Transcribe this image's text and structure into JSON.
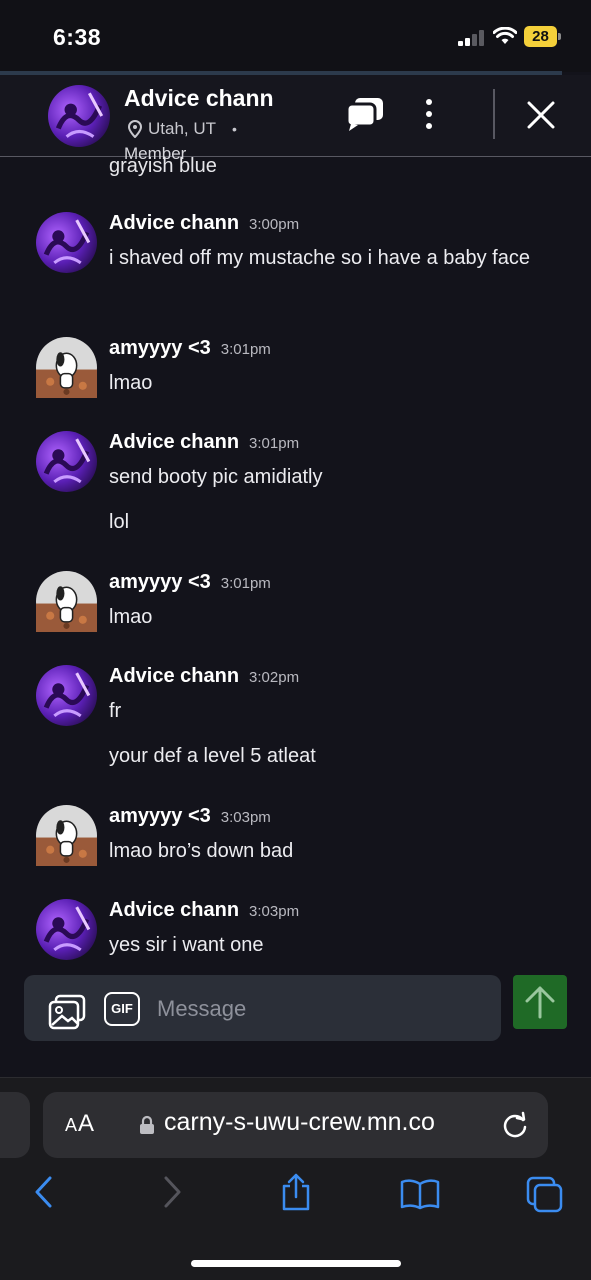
{
  "status_bar": {
    "time": "6:38",
    "battery": "28"
  },
  "header": {
    "name": "Advice chann",
    "location": "Utah, UT",
    "separator": "•",
    "role": "Member"
  },
  "messages": {
    "previous_text": "grayish blue",
    "items": [
      {
        "user": "Advice chann",
        "time": "3:00pm",
        "text": "i shaved off my mustache so i have a baby face",
        "extra": ""
      },
      {
        "user": "amyyyy <3",
        "time": "3:01pm",
        "text": "lmao",
        "extra": ""
      },
      {
        "user": "Advice chann",
        "time": "3:01pm",
        "text": "send booty pic amidiatly",
        "extra": "lol"
      },
      {
        "user": "amyyyy <3",
        "time": "3:01pm",
        "text": "lmao",
        "extra": ""
      },
      {
        "user": "Advice chann",
        "time": "3:02pm",
        "text": "fr",
        "extra": "your def a level 5 atleat"
      },
      {
        "user": "amyyyy <3",
        "time": "3:03pm",
        "text": "lmao bro’s down bad",
        "extra": ""
      },
      {
        "user": "Advice chann",
        "time": "3:03pm",
        "text": "yes sir i want one",
        "extra": ""
      }
    ]
  },
  "composer": {
    "gif_label": "GIF",
    "placeholder": "Message"
  },
  "browser": {
    "text_size_small": "A",
    "text_size_large": "A",
    "url": "carny-s-uwu-crew.mn.co"
  },
  "colors": {
    "background": "#13131b",
    "send_button": "#1f6a26",
    "link_blue": "#3b8cf0",
    "battery": "#f4d03a"
  },
  "icons": [
    "signal-icon",
    "wifi-icon",
    "battery-icon",
    "location-pin-icon",
    "chat-bubbles-icon",
    "more-vertical-icon",
    "close-icon",
    "image-icon",
    "gif-icon",
    "send-arrow-icon",
    "lock-icon",
    "reload-icon",
    "back-icon",
    "forward-icon",
    "share-icon",
    "bookmarks-icon",
    "tabs-icon"
  ]
}
